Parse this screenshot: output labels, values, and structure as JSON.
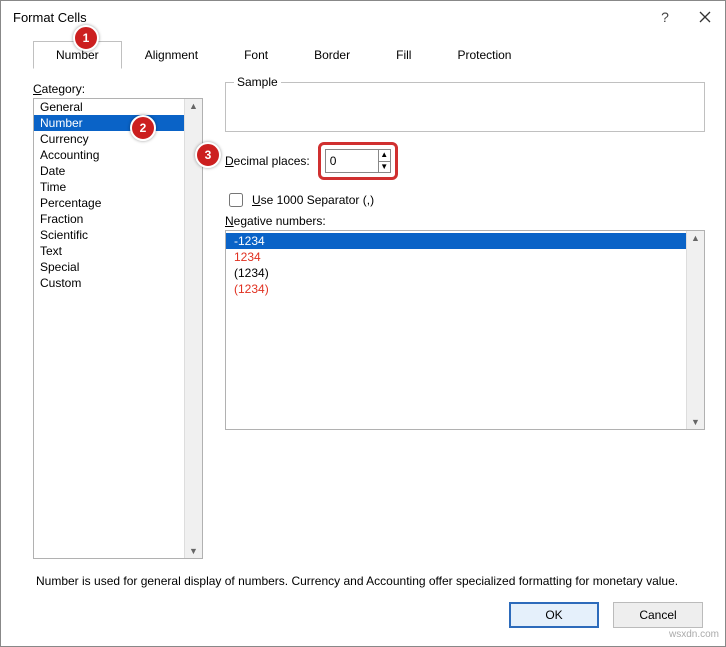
{
  "title": "Format Cells",
  "help": "?",
  "tabs": [
    "Number",
    "Alignment",
    "Font",
    "Border",
    "Fill",
    "Protection"
  ],
  "activeTab": "Number",
  "categoryLabel": "Category:",
  "categories": [
    "General",
    "Number",
    "Currency",
    "Accounting",
    "Date",
    "Time",
    "Percentage",
    "Fraction",
    "Scientific",
    "Text",
    "Special",
    "Custom"
  ],
  "selectedCategory": "Number",
  "sampleLabel": "Sample",
  "decimal": {
    "label": "Decimal places:",
    "value": "0"
  },
  "sep": {
    "label": "Use 1000 Separator (,)",
    "checked": false
  },
  "negLabel": "Negative numbers:",
  "negatives": [
    {
      "text": "-1234",
      "red": false,
      "sel": true
    },
    {
      "text": "1234",
      "red": true,
      "sel": false
    },
    {
      "text": "(1234)",
      "red": false,
      "sel": false
    },
    {
      "text": "(1234)",
      "red": true,
      "sel": false
    }
  ],
  "desc": "Number is used for general display of numbers.  Currency and Accounting offer specialized formatting for monetary value.",
  "ok": "OK",
  "cancel": "Cancel",
  "annot": {
    "a1": "1",
    "a2": "2",
    "a3": "3"
  },
  "watermark": "wsxdn.com"
}
